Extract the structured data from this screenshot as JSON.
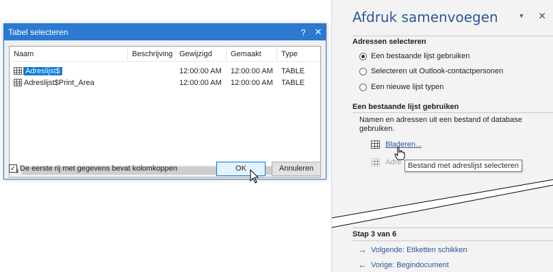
{
  "dialog": {
    "title": "Tabel selecteren",
    "help_label": "?",
    "close_label": "✕",
    "columns": [
      "Naam",
      "Beschrijving",
      "Gewijzigd",
      "Gemaakt",
      "Type"
    ],
    "rows": [
      {
        "name": "Adreslijst$",
        "description": "",
        "modified": "12:00:00 AM",
        "created": "12:00:00 AM",
        "type": "TABLE",
        "selected": true
      },
      {
        "name": "Adreslijst$Print_Area",
        "description": "",
        "modified": "12:00:00 AM",
        "created": "12:00:00 AM",
        "type": "TABLE",
        "selected": false
      }
    ],
    "scroll_left": "◀",
    "scroll_right": "▶",
    "checkbox_label": "De eerste rij met gegevens bevat kolomkoppen",
    "checkbox_mark": "✓",
    "ok_label": "OK",
    "cancel_label": "Annuleren"
  },
  "pane": {
    "title": "Afdruk samenvoegen",
    "dropdown_glyph": "▼",
    "close_glyph": "✕",
    "section1_title": "Adressen selecteren",
    "options": [
      {
        "label": "Een bestaande lijst gebruiken",
        "checked": true
      },
      {
        "label": "Selecteren uit Outlook-contactpersonen",
        "checked": false
      },
      {
        "label": "Een nieuwe lijst typen",
        "checked": false
      }
    ],
    "section2_title": "Een bestaande lijst gebruiken",
    "description": "Namen en adressen uit een bestand of database gebruiken.",
    "browse_label": "Bladeren...",
    "edit_label": "Adre",
    "tooltip": "Bestand met adreslijst selecteren",
    "step_label": "Stap 3 van 6",
    "next_label": "Volgende: Etiketten schikken",
    "prev_label": "Vorige: Begindocument",
    "next_arrow": "→",
    "prev_arrow": "←"
  }
}
